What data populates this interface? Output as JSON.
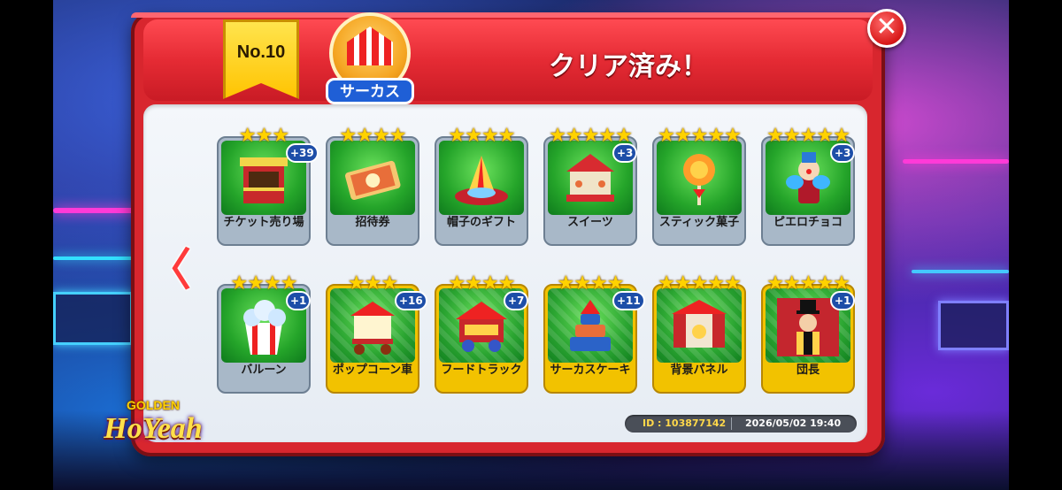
{
  "title": "クリア済み！",
  "ribbon": "No.10",
  "emblem_label": "サーカス",
  "close_symbol": "✕",
  "nav_prev_symbol": "〈",
  "footer": {
    "id": "ID : 103877142",
    "datetime": "2026/05/02 19:40"
  },
  "logo": {
    "top": "GOLDEN",
    "main": "HoYeah"
  },
  "cards": [
    {
      "label": "チケット売り場",
      "stars": "★★★",
      "badge": "+39",
      "gold": false,
      "icon": "ticket-booth-icon"
    },
    {
      "label": "招待券",
      "stars": "★★★★",
      "badge": "",
      "gold": false,
      "icon": "invitation-ticket-icon"
    },
    {
      "label": "帽子のギフト",
      "stars": "★★★★",
      "badge": "",
      "gold": false,
      "icon": "party-hat-icon"
    },
    {
      "label": "スイーツ",
      "stars": "★★★★★",
      "badge": "+3",
      "gold": false,
      "icon": "carousel-sweets-icon"
    },
    {
      "label": "スティック菓子",
      "stars": "★★★★★",
      "badge": "",
      "gold": false,
      "icon": "lollipop-icon"
    },
    {
      "label": "ピエロチョコ",
      "stars": "★★★★★",
      "badge": "+3",
      "gold": false,
      "icon": "clown-choco-icon"
    },
    {
      "label": "バルーン",
      "stars": "★★★★",
      "badge": "+1",
      "gold": false,
      "icon": "popcorn-balloon-icon"
    },
    {
      "label": "ポップコーン車",
      "stars": "★★★",
      "badge": "+16",
      "gold": true,
      "icon": "popcorn-cart-icon"
    },
    {
      "label": "フードトラック",
      "stars": "★★★★",
      "badge": "+7",
      "gold": true,
      "icon": "food-truck-icon"
    },
    {
      "label": "サーカスケーキ",
      "stars": "★★★★",
      "badge": "+11",
      "gold": true,
      "icon": "circus-cake-icon"
    },
    {
      "label": "背景パネル",
      "stars": "★★★★★",
      "badge": "",
      "gold": true,
      "icon": "stage-backdrop-icon"
    },
    {
      "label": "団長",
      "stars": "★★★★★",
      "badge": "+1",
      "gold": true,
      "icon": "ringmaster-icon"
    }
  ]
}
